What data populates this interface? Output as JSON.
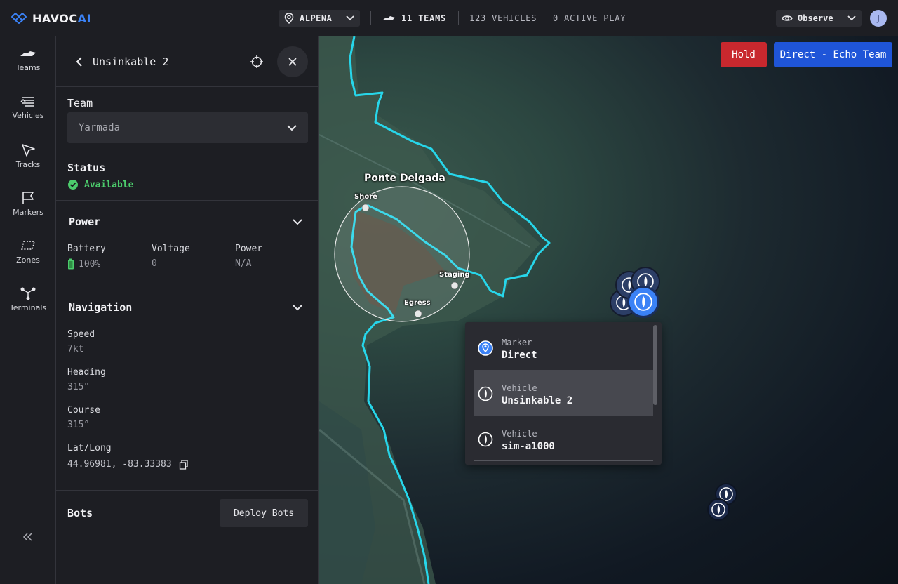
{
  "header": {
    "brand": "HAVOC",
    "brand_accent": "AI",
    "location": "ALPENA",
    "teams": "11 TEAMS",
    "vehicles": "123 VEHICLES",
    "plays": "0 ACTIVE PLAY",
    "mode": "Observe",
    "user_initial": "J"
  },
  "rail": {
    "items": [
      {
        "label": "Teams",
        "icon": "boat-icon"
      },
      {
        "label": "Vehicles",
        "icon": "vehicles-icon"
      },
      {
        "label": "Tracks",
        "icon": "cursor-arrow-icon"
      },
      {
        "label": "Markers",
        "icon": "flag-icon"
      },
      {
        "label": "Zones",
        "icon": "zone-icon"
      },
      {
        "label": "Terminals",
        "icon": "network-icon"
      }
    ]
  },
  "panel": {
    "title": "Unsinkable 2",
    "team": {
      "heading": "Team",
      "value": "Yarmada"
    },
    "status": {
      "heading": "Status",
      "value": "Available"
    },
    "power": {
      "heading": "Power",
      "battery_label": "Battery",
      "battery_value": "100%",
      "voltage_label": "Voltage",
      "voltage_value": "0",
      "power_label": "Power",
      "power_value": "N/A"
    },
    "navigation": {
      "heading": "Navigation",
      "speed_label": "Speed",
      "speed_value": "7kt",
      "heading_label": "Heading",
      "heading_value": "315°",
      "course_label": "Course",
      "course_value": "315°",
      "latlong_label": "Lat/Long",
      "latlong_value": "44.96981, -83.33383"
    },
    "bots": {
      "heading": "Bots",
      "deploy_label": "Deploy Bots"
    }
  },
  "map": {
    "hold_label": "Hold",
    "direct_label": "Direct - Echo Team",
    "area_label": "Ponte Delgada",
    "points": {
      "shore": "Shore",
      "staging": "Staging",
      "egress": "Egress"
    },
    "popup": [
      {
        "type": "Marker",
        "name": "Direct",
        "icon": "marker-pin-icon"
      },
      {
        "type": "Vehicle",
        "name": "Unsinkable 2",
        "icon": "vessel-icon"
      },
      {
        "type": "Vehicle",
        "name": "sim-a1000",
        "icon": "vessel-icon"
      }
    ]
  },
  "colors": {
    "accent": "#3b82f6",
    "hold": "#c8282e",
    "direct": "#1f55d8",
    "available": "#4ccc6c",
    "shoreline": "#27d6ea"
  }
}
